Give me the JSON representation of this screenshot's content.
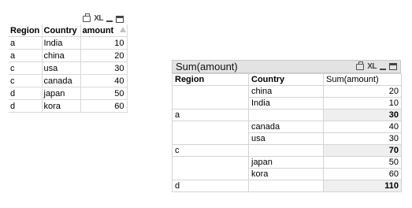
{
  "table1": {
    "icons": [
      "print-icon",
      "xl-icon",
      "minimize-icon",
      "maximize-icon"
    ],
    "xl_label": "XL",
    "headers": [
      "Region",
      "Country",
      "amount"
    ],
    "rows": [
      {
        "region": "a",
        "country": "India",
        "amount": "10"
      },
      {
        "region": "a",
        "country": "china",
        "amount": "20"
      },
      {
        "region": "c",
        "country": "usa",
        "amount": "30"
      },
      {
        "region": "c",
        "country": "canada",
        "amount": "40"
      },
      {
        "region": "d",
        "country": "japan",
        "amount": "50"
      },
      {
        "region": "d",
        "country": "kora",
        "amount": "60"
      }
    ]
  },
  "pivot": {
    "title": "Sum(amount)",
    "xl_label": "XL",
    "headers": [
      "Region",
      "Country",
      "Sum(amount)"
    ],
    "groups": [
      {
        "region": "a",
        "rows": [
          {
            "country": "china",
            "value": "20"
          },
          {
            "country": "India",
            "value": "10"
          }
        ],
        "total": "30"
      },
      {
        "region": "c",
        "rows": [
          {
            "country": "canada",
            "value": "40"
          },
          {
            "country": "usa",
            "value": "30"
          }
        ],
        "total": "70"
      },
      {
        "region": "d",
        "rows": [
          {
            "country": "japan",
            "value": "50"
          },
          {
            "country": "kora",
            "value": "60"
          }
        ],
        "total": "110"
      }
    ]
  }
}
